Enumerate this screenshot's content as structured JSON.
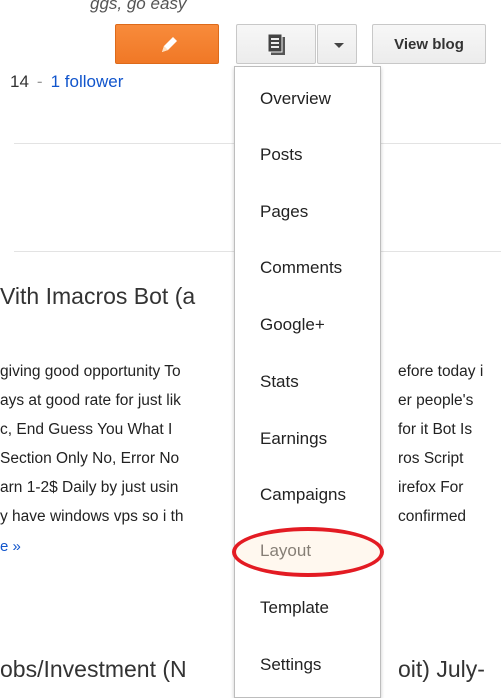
{
  "top_fade_text": "ggs, go easy",
  "toolbar": {
    "new_post_icon": "pencil-icon",
    "posts_icon": "document-icon",
    "dropdown_icon": "chevron-down-icon",
    "view_blog_label": "View blog"
  },
  "meta": {
    "year_fragment": "14",
    "separator": "-",
    "followers": "1 follower"
  },
  "posts": [
    {
      "title": "Vith Imacros Bot (a",
      "excerpt_lines": [
        "giving good opportunity To",
        "ays at good rate for just lik",
        "c, End Guess You What I",
        " Section Only No, Error No",
        "arn 1-2$ Daily by just usin",
        "y have windows vps so i th"
      ],
      "excerpt_right_lines": [
        "efore today i",
        "er people's",
        "for it Bot Is",
        "ros Script",
        "irefox For",
        "confirmed"
      ],
      "more": "e »"
    },
    {
      "title": "obs/Investment (N",
      "title_right": "oit) July-"
    }
  ],
  "menu": {
    "items": [
      "Overview",
      "Posts",
      "Pages",
      "Comments",
      "Google+",
      "Stats",
      "Earnings",
      "Campaigns",
      "Layout",
      "Template",
      "Settings"
    ],
    "highlighted": "Layout"
  },
  "colors": {
    "orange": "#f07826",
    "link": "#1155cc",
    "highlight": "#e31b23"
  }
}
